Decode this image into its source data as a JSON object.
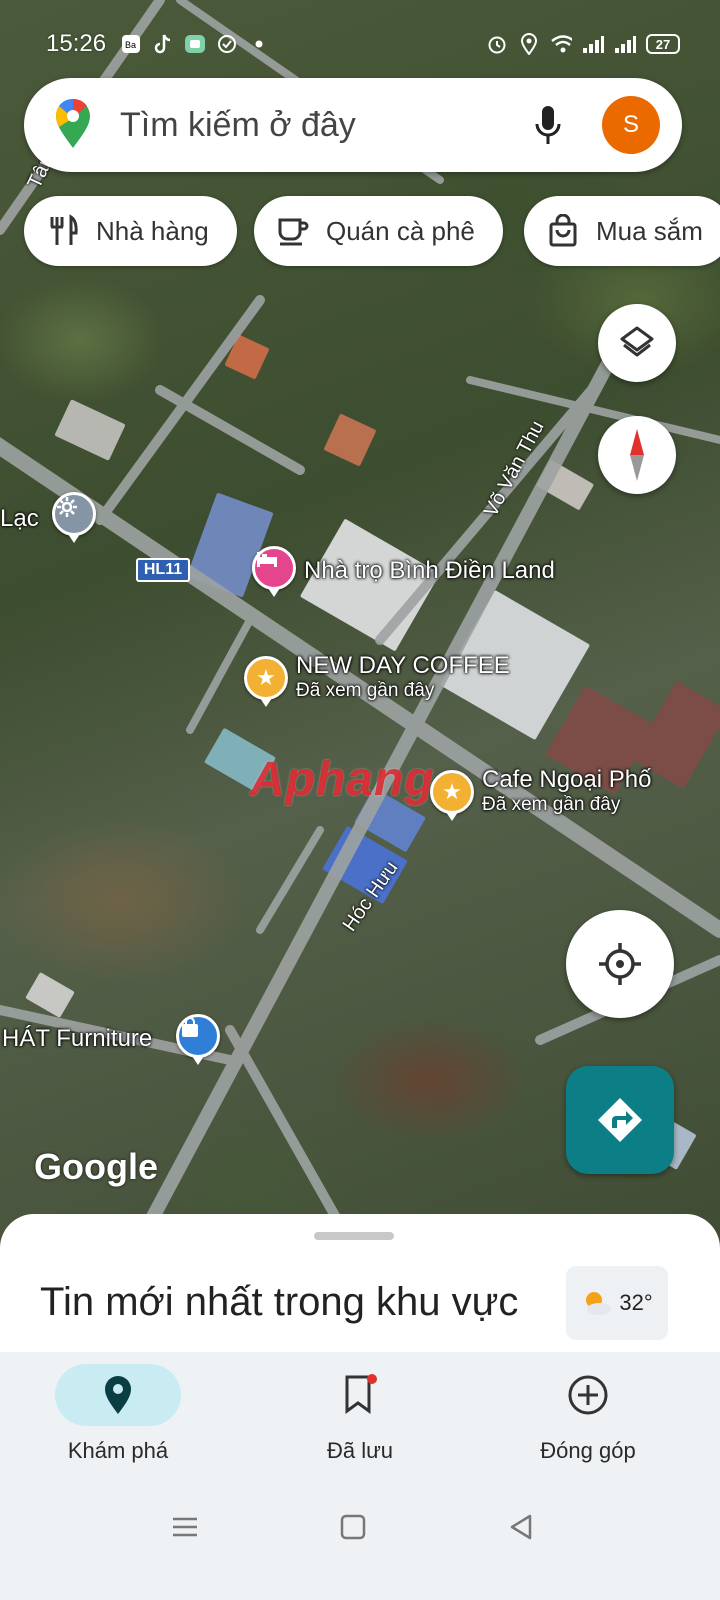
{
  "status_bar": {
    "time": "15:26",
    "battery": "27",
    "left_icons": [
      "messenger-icon",
      "tiktok-icon",
      "chat-app-icon",
      "vpn-icon",
      "dot-icon"
    ],
    "right_icons": [
      "alarm-icon",
      "location-icon",
      "wifi-icon",
      "signal-icon",
      "signal-icon"
    ]
  },
  "search": {
    "placeholder": "Tìm kiếm ở đây",
    "avatar_letter": "S",
    "avatar_color": "#ea6a00"
  },
  "chips": [
    {
      "label": "Nhà hàng",
      "icon": "restaurant-icon"
    },
    {
      "label": "Quán cà phê",
      "icon": "coffee-icon"
    },
    {
      "label": "Mua sắm",
      "icon": "shopping-bag-icon"
    }
  ],
  "map": {
    "type": "satellite",
    "road_labels": {
      "vo_van_thu": "Võ Văn Thu",
      "hoc_huu": "Hóc Hưu",
      "tan": "Tân"
    },
    "highway_badge": "HL11",
    "pois": {
      "lac": {
        "label": "Lạc",
        "icon": "gear-icon"
      },
      "nha_tro": {
        "label": "Nhà trọ Bình Điền Land",
        "icon": "bed-icon",
        "color": "#e5458c"
      },
      "new_day": {
        "label": "NEW DAY COFFEE",
        "sub": "Đã xem gần đây",
        "icon": "star-icon",
        "color": "#f2b132"
      },
      "cafe_ngoai_pho": {
        "label": "Cafe Ngoại Phố",
        "sub": "Đã xem gần đây",
        "icon": "star-icon",
        "color": "#f2b132"
      },
      "furniture": {
        "label": "HÁT Furniture",
        "icon": "shopping-bag-icon",
        "color": "#2f7fd8"
      }
    },
    "attribution": "Google",
    "watermark": "Aphang"
  },
  "map_controls": {
    "layers": "layers-icon",
    "compass": "compass-icon",
    "my_location": "my-location-icon",
    "directions": "directions-icon",
    "directions_color": "#0b7e86"
  },
  "sheet": {
    "title": "Tin mới nhất trong khu vực",
    "weather_temp": "32°",
    "weather_icon": "sun-cloud-icon"
  },
  "nav": {
    "items": [
      {
        "label": "Khám phá",
        "icon": "location-pin-icon",
        "active": true
      },
      {
        "label": "Đã lưu",
        "icon": "bookmark-icon",
        "active": false,
        "badge": true
      },
      {
        "label": "Đóng góp",
        "icon": "add-circle-icon",
        "active": false
      }
    ],
    "active_color": "#c8ecf2"
  }
}
